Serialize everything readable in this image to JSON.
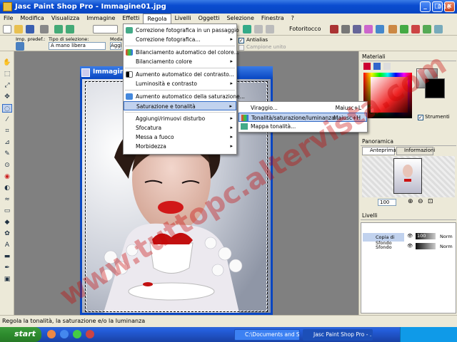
{
  "app": {
    "title": "Jasc Paint Shop Pro - Immagine01.jpg"
  },
  "menubar": [
    "File",
    "Modifica",
    "Visualizza",
    "Immagine",
    "Effetti",
    "Regola",
    "Livelli",
    "Oggetti",
    "Selezione",
    "Finestra",
    "?"
  ],
  "toolbar": {
    "fotoritocco": "Fotoritocco"
  },
  "tool_options": {
    "imp_label": "Imp. predef.:",
    "type_label": "Tipo di selezione:",
    "type_value": "A mano libera",
    "mode_label": "Modal",
    "antialias": "Antialias",
    "sample_merged": "Campione unito",
    "aggi": "Aggi"
  },
  "document": {
    "title": "Immagine01"
  },
  "menu_regola": {
    "items": [
      {
        "label": "Correzione fotografica in un passaggio",
        "arrow": ""
      },
      {
        "label": "Correzione fotografica...",
        "arrow": "▸"
      },
      {
        "label": "Bilanciamento automatico del colore...",
        "arrow": ""
      },
      {
        "label": "Bilanciamento colore",
        "arrow": "▸"
      },
      {
        "label": "Aumento automatico del contrasto...",
        "arrow": ""
      },
      {
        "label": "Luminosità e contrasto",
        "arrow": "▸"
      },
      {
        "label": "Aumento automatico della saturazione...",
        "arrow": ""
      },
      {
        "label": "Saturazione e tonalità",
        "arrow": "▸"
      },
      {
        "label": "Aggiungi/rimuovi disturbo",
        "arrow": "▸"
      },
      {
        "label": "Sfocatura",
        "arrow": "▸"
      },
      {
        "label": "Messa a fuoco",
        "arrow": "▸"
      },
      {
        "label": "Morbidezza",
        "arrow": "▸"
      }
    ]
  },
  "submenu": {
    "items": [
      {
        "label": "Viraggio...",
        "shortcut": "Maiusc+L"
      },
      {
        "label": "Tonalità/saturazione/luminanza...",
        "shortcut": "Maiusc+H"
      },
      {
        "label": "Mappa tonalità...",
        "shortcut": ""
      }
    ]
  },
  "panels": {
    "materiali": "Materiali",
    "strumenti": "Strumenti",
    "panoramica": "Panoramica",
    "anteprima": "Anteprima",
    "informazioni": "Informazioni",
    "zoom": "100",
    "livelli": "Livelli",
    "layers": [
      {
        "name": "Copia di Sfondo",
        "opacity": "100",
        "mode": "Norm"
      },
      {
        "name": "Sfondo",
        "opacity": "",
        "mode": "Norm"
      }
    ]
  },
  "status": {
    "text": "Regola la tonalità, la saturazione e/o la luminanza"
  },
  "taskbar": {
    "start": "start",
    "items": [
      "C:\\Documents and Se...",
      "Jasc Paint Shop Pro - ..."
    ],
    "clock": "0.16"
  },
  "watermark": "www.tuttopc.altervista.com"
}
